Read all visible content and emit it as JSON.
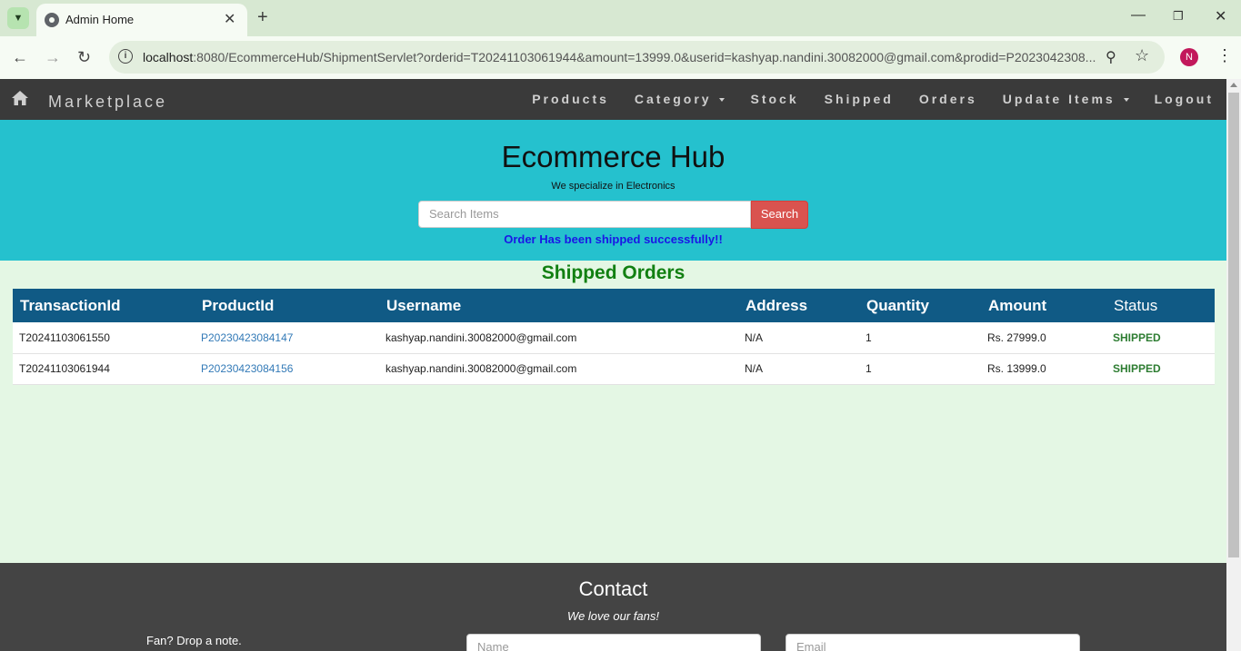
{
  "browser": {
    "tab_title": "Admin Home",
    "url_host": "localhost",
    "url_rest": ":8080/EcommerceHub/ShipmentServlet?orderid=T20241103061944&amount=13999.0&userid=kashyap.nandini.30082000@gmail.com&prodid=P2023042308...",
    "profile_initial": "N",
    "icons": [
      "tab-menu-icon",
      "favicon-icon",
      "close-icon",
      "plus-icon",
      "minimize-icon",
      "restore-icon",
      "window-close-icon",
      "back-icon",
      "forward-icon",
      "reload-icon",
      "site-info-icon",
      "zoom-icon",
      "star-icon",
      "kebab-icon"
    ]
  },
  "navbar": {
    "brand": "Marketplace",
    "items": [
      {
        "label": "Products",
        "dropdown": false
      },
      {
        "label": "Category",
        "dropdown": true
      },
      {
        "label": "Stock",
        "dropdown": false
      },
      {
        "label": "Shipped",
        "dropdown": false
      },
      {
        "label": "Orders",
        "dropdown": false
      },
      {
        "label": "Update Items",
        "dropdown": true
      },
      {
        "label": "Logout",
        "dropdown": false
      }
    ]
  },
  "hero": {
    "title": "Ecommerce Hub",
    "subtitle": "We specialize in Electronics",
    "search_placeholder": "Search Items",
    "search_button": "Search",
    "message": "Order Has been shipped successfully!!",
    "bg_color": "#25c1ce"
  },
  "orders": {
    "title": "Shipped Orders",
    "columns": [
      "TransactionId",
      "ProductId",
      "Username",
      "Address",
      "Quantity",
      "Amount",
      "Status"
    ],
    "rows": [
      {
        "transaction_id": "T20241103061550",
        "product_id": "P20230423084147",
        "username": "kashyap.nandini.30082000@gmail.com",
        "address": "N/A",
        "quantity": "1",
        "amount": "Rs. 27999.0",
        "status": "SHIPPED"
      },
      {
        "transaction_id": "T20241103061944",
        "product_id": "P20230423084156",
        "username": "kashyap.nandini.30082000@gmail.com",
        "address": "N/A",
        "quantity": "1",
        "amount": "Rs. 13999.0",
        "status": "SHIPPED"
      }
    ],
    "header_color": "#105a85"
  },
  "footer": {
    "title": "Contact",
    "subtitle": "We love our fans!",
    "note": "Fan? Drop a note.",
    "name_placeholder": "Name",
    "email_placeholder": "Email"
  }
}
